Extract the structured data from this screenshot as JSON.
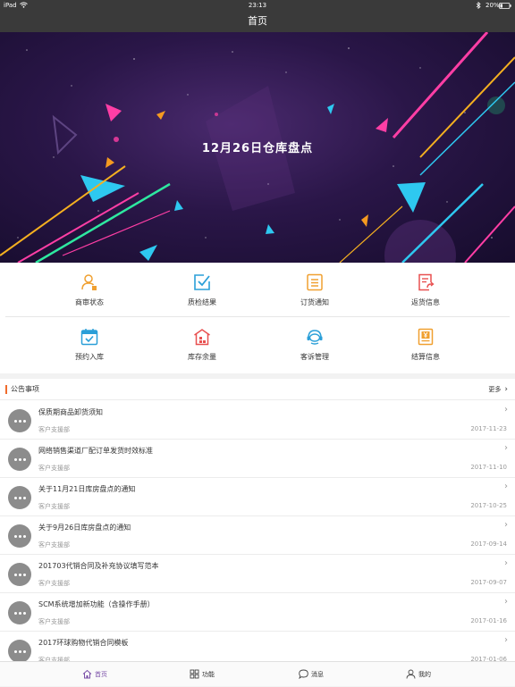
{
  "status_bar": {
    "device": "iPad",
    "time": "23:13",
    "battery": "20%"
  },
  "nav": {
    "title": "首页"
  },
  "banner": {
    "text": "12月26日仓库盘点",
    "page_count": 6,
    "active_page": 0
  },
  "grid": {
    "items": [
      {
        "label": "商审状态",
        "icon": "user-icon",
        "color": "#f0a030"
      },
      {
        "label": "质检结果",
        "icon": "checkbox-icon",
        "color": "#2a9fd8"
      },
      {
        "label": "订货通知",
        "icon": "list-doc-icon",
        "color": "#f0a030"
      },
      {
        "label": "返货信息",
        "icon": "return-doc-icon",
        "color": "#e85050"
      },
      {
        "label": "预约入库",
        "icon": "calendar-check-icon",
        "color": "#2a9fd8"
      },
      {
        "label": "库存余量",
        "icon": "warehouse-icon",
        "color": "#e85050"
      },
      {
        "label": "客诉管理",
        "icon": "headset-icon",
        "color": "#2a9fd8"
      },
      {
        "label": "结算信息",
        "icon": "yen-doc-icon",
        "color": "#f0a030"
      }
    ]
  },
  "notice": {
    "title": "公告事项",
    "more_label": "更多",
    "items": [
      {
        "title": "保质期商品卸货须知",
        "dept": "客户支援部",
        "date": "2017-11-23"
      },
      {
        "title": "网络销售渠道厂配订单发货时效标准",
        "dept": "客户支援部",
        "date": "2017-11-10"
      },
      {
        "title": "关于11月21日库房盘点的通知",
        "dept": "客户支援部",
        "date": "2017-10-25"
      },
      {
        "title": "关于9月26日库房盘点的通知",
        "dept": "客户支援部",
        "date": "2017-09-14"
      },
      {
        "title": "201703代销合同及补充协议填写范本",
        "dept": "客户支援部",
        "date": "2017-09-07"
      },
      {
        "title": "SCM系统增加新功能（含操作手册）",
        "dept": "客户支援部",
        "date": "2017-01-16"
      },
      {
        "title": "2017环球购物代销合同模板",
        "dept": "客户支援部",
        "date": "2017-01-06"
      }
    ]
  },
  "tabbar": {
    "items": [
      {
        "label": "首页",
        "icon": "home-icon",
        "active": true
      },
      {
        "label": "功能",
        "icon": "grid-icon",
        "active": false
      },
      {
        "label": "消息",
        "icon": "chat-bubble-icon",
        "active": false
      },
      {
        "label": "我的",
        "icon": "person-icon",
        "active": false
      }
    ],
    "active_color": "#7a4fa8"
  }
}
